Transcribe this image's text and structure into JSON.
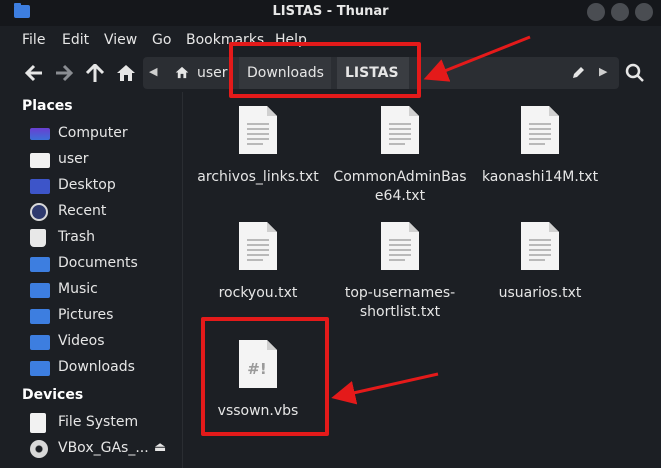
{
  "window": {
    "title": "LISTAS - Thunar"
  },
  "menu": [
    "File",
    "Edit",
    "View",
    "Go",
    "Bookmarks",
    "Help"
  ],
  "path": {
    "home": "user",
    "parent": "Downloads",
    "current": "LISTAS"
  },
  "sidebar": {
    "places_title": "Places",
    "places": [
      {
        "label": "Computer",
        "icon": "computer-icon"
      },
      {
        "label": "user",
        "icon": "home-folder-icon"
      },
      {
        "label": "Desktop",
        "icon": "desktop-icon"
      },
      {
        "label": "Recent",
        "icon": "recent-icon"
      },
      {
        "label": "Trash",
        "icon": "trash-icon"
      },
      {
        "label": "Documents",
        "icon": "documents-icon"
      },
      {
        "label": "Music",
        "icon": "music-icon"
      },
      {
        "label": "Pictures",
        "icon": "pictures-icon"
      },
      {
        "label": "Videos",
        "icon": "videos-icon"
      },
      {
        "label": "Downloads",
        "icon": "downloads-icon"
      }
    ],
    "devices_title": "Devices",
    "devices": [
      {
        "label": "File System",
        "icon": "drive-icon"
      },
      {
        "label": "VBox_GAs_...",
        "icon": "optical-disc-icon"
      }
    ]
  },
  "files": [
    {
      "name": "archivos_links.txt",
      "type": "text"
    },
    {
      "name": "CommonAdminBase64.txt",
      "line1": "CommonAdminBas",
      "line2": "e64.txt",
      "type": "text"
    },
    {
      "name": "kaonashi14M.txt",
      "type": "text"
    },
    {
      "name": "rockyou.txt",
      "type": "text"
    },
    {
      "name": "top-usernames-shortlist.txt",
      "line1": "top-usernames-",
      "line2": "shortlist.txt",
      "type": "text"
    },
    {
      "name": "usuarios.txt",
      "type": "text"
    },
    {
      "name": "vssown.vbs",
      "type": "script",
      "glyph": "#!"
    }
  ],
  "colors": {
    "accent": "#3d7ee0",
    "annotation": "#e41a1a",
    "background": "#1c1f24"
  }
}
